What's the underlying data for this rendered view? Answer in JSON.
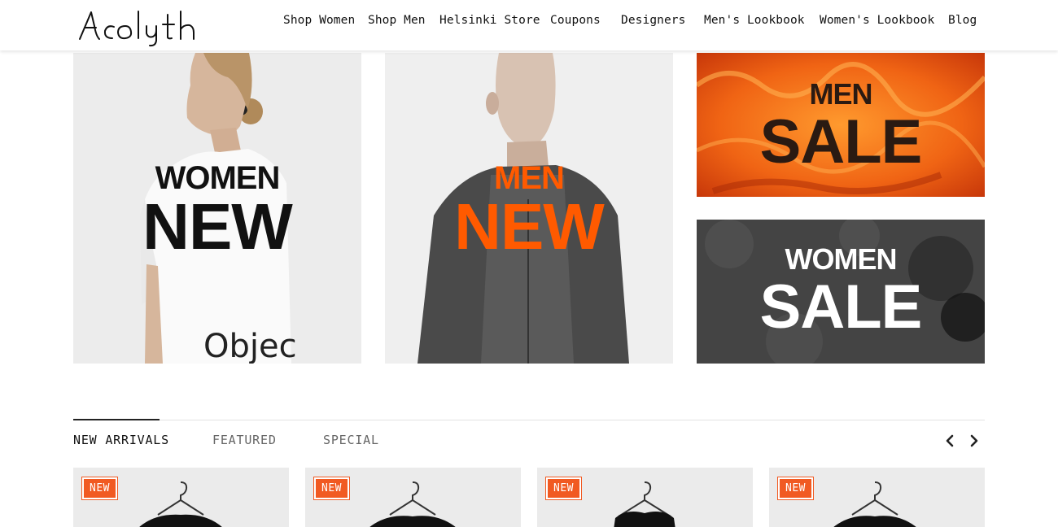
{
  "brand": {
    "logo_text": "Acolyth"
  },
  "nav": {
    "items": [
      {
        "label": "Shop Women"
      },
      {
        "label": "Shop Men"
      },
      {
        "label": "Helsinki Store"
      },
      {
        "label": "Coupons"
      },
      {
        "label": "Designers"
      },
      {
        "label": "Men's Lookbook"
      },
      {
        "label": "Women's Lookbook"
      },
      {
        "label": "Blog"
      }
    ]
  },
  "banners": {
    "women_new": {
      "line1": "WOMEN",
      "line2": "NEW",
      "shirt_text": "Objec"
    },
    "men_new": {
      "line1": "MEN",
      "line2": "NEW"
    },
    "men_sale": {
      "line1": "MEN",
      "line2": "SALE"
    },
    "women_sale": {
      "line1": "WOMEN",
      "line2": "SALE"
    }
  },
  "tabs": [
    {
      "label": "NEW ARRIVALS",
      "active": true
    },
    {
      "label": "FEATURED",
      "active": false
    },
    {
      "label": "SPECIAL",
      "active": false
    }
  ],
  "carousel": {
    "prev_icon": "chevron-left-icon",
    "next_icon": "chevron-right-icon"
  },
  "products": [
    {
      "badge": "NEW"
    },
    {
      "badge": "NEW"
    },
    {
      "badge": "NEW"
    },
    {
      "badge": "NEW"
    }
  ],
  "colors": {
    "accent": "#f15a22",
    "men_new_text": "#ff5a00",
    "text": "#111111"
  }
}
